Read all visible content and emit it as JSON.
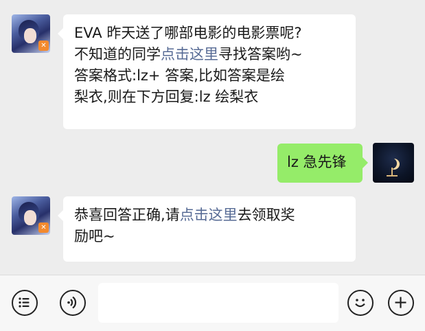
{
  "messages": [
    {
      "side": "left",
      "avatar": "game-character-avatar",
      "parts": [
        {
          "line": [
            "EVA 昨天送了哪部电影的电影票呢?"
          ]
        },
        {
          "line": [
            "不知道的同学",
            {
              "link": "点击这里"
            },
            "寻找答案哟~"
          ]
        },
        {
          "line": [
            "答案格式:lz+ 答案,比如答案是绘"
          ]
        },
        {
          "line": [
            "梨衣,则在下方回复:lz 绘梨衣"
          ]
        }
      ]
    },
    {
      "side": "right",
      "avatar": "moon-avatar",
      "text": "lz 急先锋"
    },
    {
      "side": "left",
      "avatar": "game-character-avatar",
      "parts": [
        {
          "line": [
            "恭喜回答正确,请",
            {
              "link": "点击这里"
            },
            "去领取奖"
          ]
        },
        {
          "line": [
            "励吧~"
          ]
        }
      ]
    }
  ],
  "m1": {
    "l1": "EVA 昨天送了哪部电影的电影票呢?",
    "l2a": "不知道的同学",
    "l2link": "点击这里",
    "l2b": "寻找答案哟~",
    "l3": "答案格式:lz+ 答案,比如答案是绘",
    "l4": "梨衣,则在下方回复:lz 绘梨衣"
  },
  "m2": {
    "text": "lz 急先锋"
  },
  "m3": {
    "l1a": "恭喜回答正确,请",
    "l1link": "点击这里",
    "l1b": "去领取奖",
    "l2": "励吧~"
  },
  "badge_text": "✕",
  "input_bar": {
    "left_icons": [
      "menu-list-icon",
      "voice-icon"
    ],
    "right_icons": [
      "emoji-icon",
      "plus-icon"
    ],
    "input_value": ""
  },
  "colors": {
    "background": "#ededed",
    "bubble_left": "#ffffff",
    "bubble_right": "#95ec69",
    "link": "#576b95"
  }
}
